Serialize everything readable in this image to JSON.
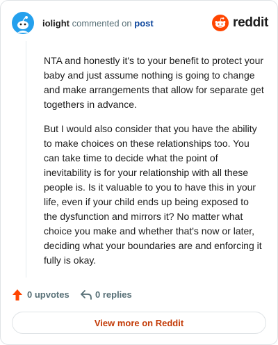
{
  "header": {
    "username": "iolight",
    "commented_text": "commented on",
    "post_link": "post",
    "brand": "reddit"
  },
  "comment": {
    "paragraphs": [
      "NTA and honestly it's to your benefit to protect your baby and just assume nothing is going to change and make arrangements that allow for separate get togethers in advance.",
      "But I would also consider that you have the ability to make choices on these relationships too. You can take time to decide what the point of inevitability is for your relationship with all these people is. Is it valuable to you to have this in your life, even if your child ends up being exposed to the dysfunction and mirrors it? No matter what choice you make and whether that's now or later, deciding what your boundaries are and enforcing it fully is okay."
    ]
  },
  "actions": {
    "upvotes_label": "0 upvotes",
    "replies_label": "0 replies"
  },
  "footer": {
    "view_more_label": "View more on Reddit"
  },
  "colors": {
    "accent": "#ff4500",
    "link": "#0a449b",
    "cta_text": "#c33b07",
    "avatar_bg": "#24a0ed"
  },
  "icons": {
    "avatar": "snoo-avatar-icon",
    "brand": "reddit-logo-icon",
    "upvote": "upvote-arrow-icon",
    "reply": "reply-arrow-icon"
  }
}
